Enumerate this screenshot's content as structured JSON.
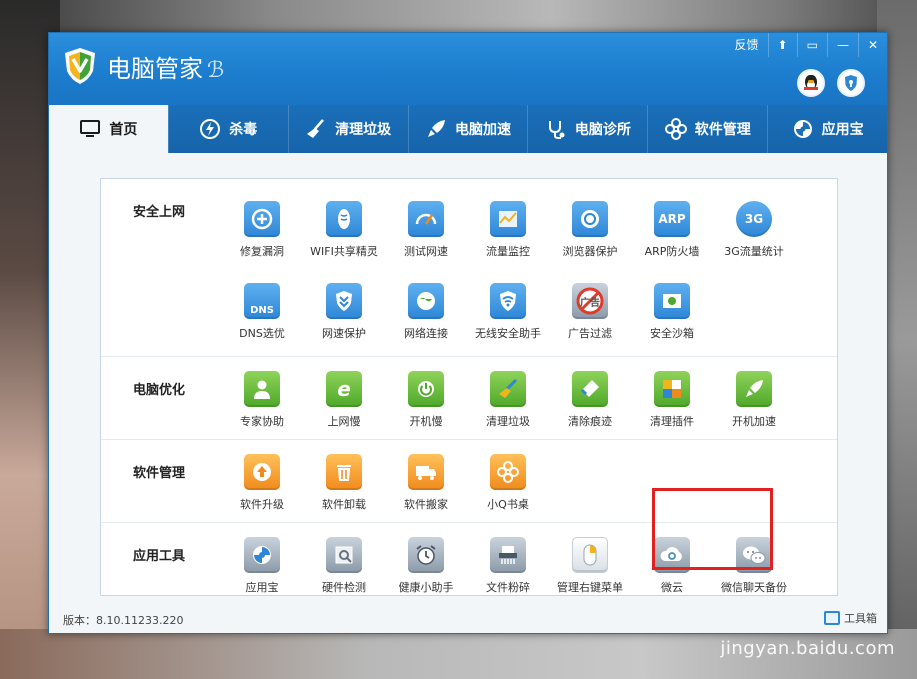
{
  "watermark": "jingyan.baidu.com",
  "window": {
    "title": "电脑管家",
    "title_mark": "ℬ",
    "controls": [
      "反馈",
      "⬆",
      "▭",
      "—",
      "✕"
    ]
  },
  "nav": {
    "items": [
      {
        "label": "首页",
        "icon": "monitor-icon",
        "active": true
      },
      {
        "label": "杀毒",
        "icon": "lightning-shield-icon"
      },
      {
        "label": "清理垃圾",
        "icon": "broom-icon"
      },
      {
        "label": "电脑加速",
        "icon": "rocket-icon"
      },
      {
        "label": "电脑诊所",
        "icon": "stethoscope-icon"
      },
      {
        "label": "软件管理",
        "icon": "flower-icon"
      },
      {
        "label": "应用宝",
        "icon": "appstore-icon"
      }
    ]
  },
  "sections": [
    {
      "title": "安全上网",
      "tools": [
        {
          "label": "修复漏洞",
          "icon": "patch-icon"
        },
        {
          "label": "WIFI共享精灵",
          "icon": "wifi-share-icon"
        },
        {
          "label": "测试网速",
          "icon": "speedometer-icon"
        },
        {
          "label": "流量监控",
          "icon": "traffic-chart-icon"
        },
        {
          "label": "浏览器保护",
          "icon": "browser-shield-icon"
        },
        {
          "label": "ARP防火墙",
          "icon": "arp-icon",
          "text": "ARP"
        },
        {
          "label": "3G流量统计",
          "icon": "3g-icon",
          "text": "3G"
        },
        {
          "label": "DNS选优",
          "icon": "dns-icon",
          "text": "DNS"
        },
        {
          "label": "网速保护",
          "icon": "chevron-shield-icon"
        },
        {
          "label": "网络连接",
          "icon": "globe-icon"
        },
        {
          "label": "无线安全助手",
          "icon": "wifi-shield-icon"
        },
        {
          "label": "广告过滤",
          "icon": "ad-block-icon",
          "text": "广告"
        },
        {
          "label": "安全沙箱",
          "icon": "sandbox-icon"
        }
      ]
    },
    {
      "title": "电脑优化",
      "tools": [
        {
          "label": "专家协助",
          "icon": "expert-icon"
        },
        {
          "label": "上网慢",
          "icon": "ie-icon"
        },
        {
          "label": "开机慢",
          "icon": "power-icon"
        },
        {
          "label": "清理垃圾",
          "icon": "broom-icon"
        },
        {
          "label": "清除痕迹",
          "icon": "eraser-icon"
        },
        {
          "label": "清理插件",
          "icon": "puzzle-icon"
        },
        {
          "label": "开机加速",
          "icon": "launch-icon"
        }
      ]
    },
    {
      "title": "软件管理",
      "tools": [
        {
          "label": "软件升级",
          "icon": "upgrade-icon"
        },
        {
          "label": "软件卸载",
          "icon": "trash-icon"
        },
        {
          "label": "软件搬家",
          "icon": "truck-icon"
        },
        {
          "label": "小Q书桌",
          "icon": "desk-icon"
        }
      ]
    },
    {
      "title": "应用工具",
      "tools": [
        {
          "label": "应用宝",
          "icon": "appstore-icon"
        },
        {
          "label": "硬件检测",
          "icon": "hardware-scan-icon"
        },
        {
          "label": "健康小助手",
          "icon": "alarm-clock-icon"
        },
        {
          "label": "文件粉碎",
          "icon": "shredder-icon"
        },
        {
          "label": "管理右键菜单",
          "icon": "mouse-icon"
        },
        {
          "label": "微云",
          "icon": "cloud-icon"
        },
        {
          "label": "微信聊天备份",
          "icon": "wechat-icon"
        }
      ]
    }
  ],
  "footer": {
    "version": "版本：8.10.11233.220",
    "toolbox": "工具箱"
  }
}
